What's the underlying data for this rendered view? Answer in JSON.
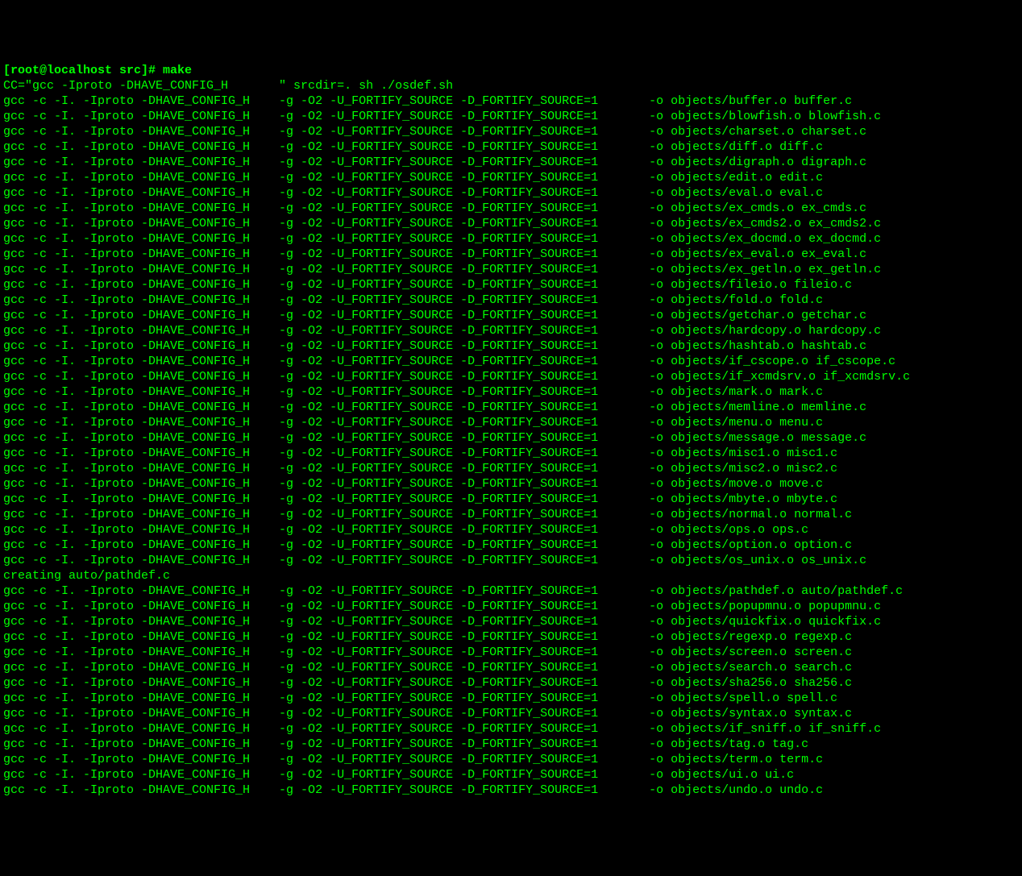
{
  "prompt": "[root@localhost src]# make",
  "cc_line": "CC=\"gcc -Iproto -DHAVE_CONFIG_H       \" srcdir=. sh ./osdef.sh",
  "gcc_prefix": "gcc -c -I. -Iproto -DHAVE_CONFIG_H    -g -O2 -U_FORTIFY_SOURCE -D_FORTIFY_SOURCE=1       -o ",
  "pathdef_line": "creating auto/pathdef.c",
  "compile_targets_block1": [
    "objects/buffer.o buffer.c",
    "objects/blowfish.o blowfish.c",
    "objects/charset.o charset.c",
    "objects/diff.o diff.c",
    "objects/digraph.o digraph.c",
    "objects/edit.o edit.c",
    "objects/eval.o eval.c",
    "objects/ex_cmds.o ex_cmds.c",
    "objects/ex_cmds2.o ex_cmds2.c",
    "objects/ex_docmd.o ex_docmd.c",
    "objects/ex_eval.o ex_eval.c",
    "objects/ex_getln.o ex_getln.c",
    "objects/fileio.o fileio.c",
    "objects/fold.o fold.c",
    "objects/getchar.o getchar.c",
    "objects/hardcopy.o hardcopy.c",
    "objects/hashtab.o hashtab.c",
    "objects/if_cscope.o if_cscope.c",
    "objects/if_xcmdsrv.o if_xcmdsrv.c",
    "objects/mark.o mark.c",
    "objects/memline.o memline.c",
    "objects/menu.o menu.c",
    "objects/message.o message.c",
    "objects/misc1.o misc1.c",
    "objects/misc2.o misc2.c",
    "objects/move.o move.c",
    "objects/mbyte.o mbyte.c",
    "objects/normal.o normal.c",
    "objects/ops.o ops.c",
    "objects/option.o option.c",
    "objects/os_unix.o os_unix.c"
  ],
  "compile_targets_block2": [
    "objects/pathdef.o auto/pathdef.c",
    "objects/popupmnu.o popupmnu.c",
    "objects/quickfix.o quickfix.c",
    "objects/regexp.o regexp.c",
    "objects/screen.o screen.c",
    "objects/search.o search.c",
    "objects/sha256.o sha256.c",
    "objects/spell.o spell.c",
    "objects/syntax.o syntax.c",
    "objects/if_sniff.o if_sniff.c",
    "objects/tag.o tag.c",
    "objects/term.o term.c",
    "objects/ui.o ui.c",
    "objects/undo.o undo.c"
  ]
}
